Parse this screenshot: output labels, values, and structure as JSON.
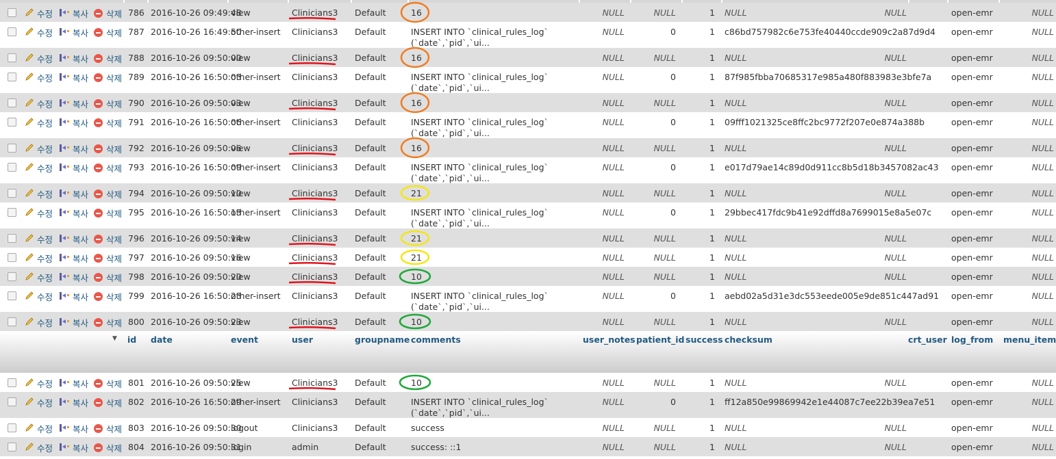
{
  "actions": {
    "edit_label": "수정",
    "copy_label": "복사",
    "delete_label": "삭제"
  },
  "columns": [
    "id",
    "date",
    "event",
    "user",
    "groupname",
    "comments",
    "user_notes",
    "patient_id",
    "success",
    "checksum",
    "crt_user",
    "log_from",
    "menu_item_id"
  ],
  "sort_icon": "triangle-down-icon",
  "annotation_colors": {
    "underline": "#e0141e",
    "orange": "#f07b1f",
    "yellow": "#f5e613",
    "green": "#1fa83a"
  },
  "rows_before_header": [
    {
      "id": "786",
      "date": "2016-10-26 09:49:48",
      "event": "view",
      "user": "Clinicians3",
      "groupname": "Default",
      "comments": [
        "16"
      ],
      "user_notes": "NULL",
      "patient_id": "NULL",
      "success": "1",
      "checksum": "NULL",
      "crt_user": "NULL",
      "log_from": "open-emr",
      "menu_item_id": "NULL",
      "mark": "orange"
    },
    {
      "id": "787",
      "date": "2016-10-26 16:49:50",
      "event": "other-insert",
      "user": "Clinicians3",
      "groupname": "Default",
      "comments": [
        "INSERT INTO `clinical_rules_log`",
        "(`date`,`pid`,`ui..."
      ],
      "user_notes": "NULL",
      "patient_id": "0",
      "success": "1",
      "checksum": "c86bd757982c6e753fe40440ccde909c2a87d9d4",
      "crt_user": "",
      "log_from": "open-emr",
      "menu_item_id": "NULL"
    },
    {
      "id": "788",
      "date": "2016-10-26 09:50:00",
      "event": "view",
      "user": "Clinicians3",
      "groupname": "Default",
      "comments": [
        "16"
      ],
      "user_notes": "NULL",
      "patient_id": "NULL",
      "success": "1",
      "checksum": "NULL",
      "crt_user": "NULL",
      "log_from": "open-emr",
      "menu_item_id": "NULL",
      "mark": "orange"
    },
    {
      "id": "789",
      "date": "2016-10-26 16:50:03",
      "event": "other-insert",
      "user": "Clinicians3",
      "groupname": "Default",
      "comments": [
        "INSERT INTO `clinical_rules_log`",
        "(`date`,`pid`,`ui..."
      ],
      "user_notes": "NULL",
      "patient_id": "0",
      "success": "1",
      "checksum": "87f985fbba70685317e985a480f883983e3bfe7a",
      "crt_user": "",
      "log_from": "open-emr",
      "menu_item_id": "NULL"
    },
    {
      "id": "790",
      "date": "2016-10-26 09:50:03",
      "event": "view",
      "user": "Clinicians3",
      "groupname": "Default",
      "comments": [
        "16"
      ],
      "user_notes": "NULL",
      "patient_id": "NULL",
      "success": "1",
      "checksum": "NULL",
      "crt_user": "NULL",
      "log_from": "open-emr",
      "menu_item_id": "NULL",
      "mark": "orange"
    },
    {
      "id": "791",
      "date": "2016-10-26 16:50:06",
      "event": "other-insert",
      "user": "Clinicians3",
      "groupname": "Default",
      "comments": [
        "INSERT INTO `clinical_rules_log`",
        "(`date`,`pid`,`ui..."
      ],
      "user_notes": "NULL",
      "patient_id": "0",
      "success": "1",
      "checksum": "09fff1021325ce8ffc2bc9772f207e0e874a388b",
      "crt_user": "",
      "log_from": "open-emr",
      "menu_item_id": "NULL"
    },
    {
      "id": "792",
      "date": "2016-10-26 09:50:06",
      "event": "view",
      "user": "Clinicians3",
      "groupname": "Default",
      "comments": [
        "16"
      ],
      "user_notes": "NULL",
      "patient_id": "NULL",
      "success": "1",
      "checksum": "NULL",
      "crt_user": "NULL",
      "log_from": "open-emr",
      "menu_item_id": "NULL",
      "mark": "orange"
    },
    {
      "id": "793",
      "date": "2016-10-26 16:50:09",
      "event": "other-insert",
      "user": "Clinicians3",
      "groupname": "Default",
      "comments": [
        "INSERT INTO `clinical_rules_log`",
        "(`date`,`pid`,`ui..."
      ],
      "user_notes": "NULL",
      "patient_id": "0",
      "success": "1",
      "checksum": "e017d79ae14c89d0d911cc8b5d18b3457082ac43",
      "crt_user": "",
      "log_from": "open-emr",
      "menu_item_id": "NULL"
    },
    {
      "id": "794",
      "date": "2016-10-26 09:50:10",
      "event": "view",
      "user": "Clinicians3",
      "groupname": "Default",
      "comments": [
        "21"
      ],
      "user_notes": "NULL",
      "patient_id": "NULL",
      "success": "1",
      "checksum": "NULL",
      "crt_user": "NULL",
      "log_from": "open-emr",
      "menu_item_id": "NULL",
      "mark": "yellow"
    },
    {
      "id": "795",
      "date": "2016-10-26 16:50:13",
      "event": "other-insert",
      "user": "Clinicians3",
      "groupname": "Default",
      "comments": [
        "INSERT INTO `clinical_rules_log`",
        "(`date`,`pid`,`ui..."
      ],
      "user_notes": "NULL",
      "patient_id": "0",
      "success": "1",
      "checksum": "29bbec417fdc9b41e92dffd8a7699015e8a5e07c",
      "crt_user": "",
      "log_from": "open-emr",
      "menu_item_id": "NULL"
    },
    {
      "id": "796",
      "date": "2016-10-26 09:50:14",
      "event": "view",
      "user": "Clinicians3",
      "groupname": "Default",
      "comments": [
        "21"
      ],
      "user_notes": "NULL",
      "patient_id": "NULL",
      "success": "1",
      "checksum": "NULL",
      "crt_user": "NULL",
      "log_from": "open-emr",
      "menu_item_id": "NULL",
      "mark": "yellow"
    },
    {
      "id": "797",
      "date": "2016-10-26 09:50:16",
      "event": "view",
      "user": "Clinicians3",
      "groupname": "Default",
      "comments": [
        "21"
      ],
      "user_notes": "NULL",
      "patient_id": "NULL",
      "success": "1",
      "checksum": "NULL",
      "crt_user": "NULL",
      "log_from": "open-emr",
      "menu_item_id": "NULL",
      "mark": "yellow"
    },
    {
      "id": "798",
      "date": "2016-10-26 09:50:20",
      "event": "view",
      "user": "Clinicians3",
      "groupname": "Default",
      "comments": [
        "10"
      ],
      "user_notes": "NULL",
      "patient_id": "NULL",
      "success": "1",
      "checksum": "NULL",
      "crt_user": "NULL",
      "log_from": "open-emr",
      "menu_item_id": "NULL",
      "mark": "green"
    },
    {
      "id": "799",
      "date": "2016-10-26 16:50:23",
      "event": "other-insert",
      "user": "Clinicians3",
      "groupname": "Default",
      "comments": [
        "INSERT INTO `clinical_rules_log`",
        "(`date`,`pid`,`ui..."
      ],
      "user_notes": "NULL",
      "patient_id": "0",
      "success": "1",
      "checksum": "aebd02a5d31e3dc553eede005e9de851c447ad91",
      "crt_user": "",
      "log_from": "open-emr",
      "menu_item_id": "NULL"
    },
    {
      "id": "800",
      "date": "2016-10-26 09:50:23",
      "event": "view",
      "user": "Clinicians3",
      "groupname": "Default",
      "comments": [
        "10"
      ],
      "user_notes": "NULL",
      "patient_id": "NULL",
      "success": "1",
      "checksum": "NULL",
      "crt_user": "NULL",
      "log_from": "open-emr",
      "menu_item_id": "NULL",
      "mark": "green"
    }
  ],
  "rows_after_header": [
    {
      "id": "801",
      "date": "2016-10-26 09:50:25",
      "event": "view",
      "user": "Clinicians3",
      "groupname": "Default",
      "comments": [
        "10"
      ],
      "user_notes": "NULL",
      "patient_id": "NULL",
      "success": "1",
      "checksum": "NULL",
      "crt_user": "NULL",
      "log_from": "open-emr",
      "menu_item_id": "NULL",
      "mark": "green"
    },
    {
      "id": "802",
      "date": "2016-10-26 16:50:29",
      "event": "other-insert",
      "user": "Clinicians3",
      "groupname": "Default",
      "comments": [
        "INSERT INTO `clinical_rules_log`",
        "(`date`,`pid`,`ui..."
      ],
      "user_notes": "NULL",
      "patient_id": "0",
      "success": "1",
      "checksum": "ff12a850e99869942e1e44087c7ee22b39ea7e51",
      "crt_user": "",
      "log_from": "open-emr",
      "menu_item_id": "NULL"
    },
    {
      "id": "803",
      "date": "2016-10-26 09:50:30",
      "event": "logout",
      "user": "Clinicians3",
      "groupname": "Default",
      "comments": [
        "success"
      ],
      "user_notes": "NULL",
      "patient_id": "NULL",
      "success": "1",
      "checksum": "NULL",
      "crt_user": "NULL",
      "log_from": "open-emr",
      "menu_item_id": "NULL"
    },
    {
      "id": "804",
      "date": "2016-10-26 09:50:31",
      "event": "login",
      "user": "admin",
      "groupname": "Default",
      "comments": [
        "success: ::1"
      ],
      "user_notes": "NULL",
      "patient_id": "NULL",
      "success": "1",
      "checksum": "NULL",
      "crt_user": "NULL",
      "log_from": "open-emr",
      "menu_item_id": "NULL"
    }
  ]
}
